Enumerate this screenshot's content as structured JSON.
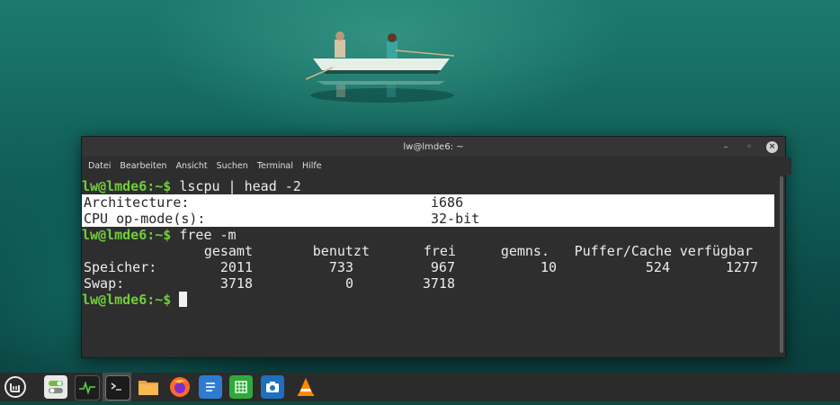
{
  "window": {
    "title": "lw@lmde6: ~",
    "controls": [
      "minimize-icon",
      "maximize-icon",
      "close-icon"
    ]
  },
  "menu": [
    "Datei",
    "Bearbeiten",
    "Ansicht",
    "Suchen",
    "Terminal",
    "Hilfe"
  ],
  "terminal": {
    "prompt": "lw@lmde6:~$",
    "cmd1": " lscpu | head -2",
    "lscpu": [
      {
        "key": "Architecture:",
        "value": "i686"
      },
      {
        "key": "CPU op-mode(s):",
        "value": "32-bit"
      }
    ],
    "cmd2": " free -m",
    "free_headers": [
      "gesamt",
      "benutzt",
      "frei",
      "gemns.",
      "Puffer/Cache",
      "verfügbar"
    ],
    "free_rows": [
      {
        "label": "Speicher:",
        "values": [
          "2011",
          "733",
          "967",
          "10",
          "524",
          "1277"
        ]
      },
      {
        "label": "Swap:",
        "values": [
          "3718",
          "0",
          "3718",
          "",
          "",
          ""
        ]
      }
    ]
  },
  "taskbar": {
    "icons": [
      "mint-menu-icon",
      "settings-toggle-icon",
      "system-monitor-icon",
      "terminal-icon",
      "files-folder-icon",
      "firefox-icon",
      "writer-document-icon",
      "calc-spreadsheet-icon",
      "camera-app-icon",
      "vlc-icon"
    ]
  },
  "colors": {
    "prompt": "#6fce3a",
    "terminal_bg": "#2e2e2e",
    "highlight_bg": "#ffffff"
  }
}
